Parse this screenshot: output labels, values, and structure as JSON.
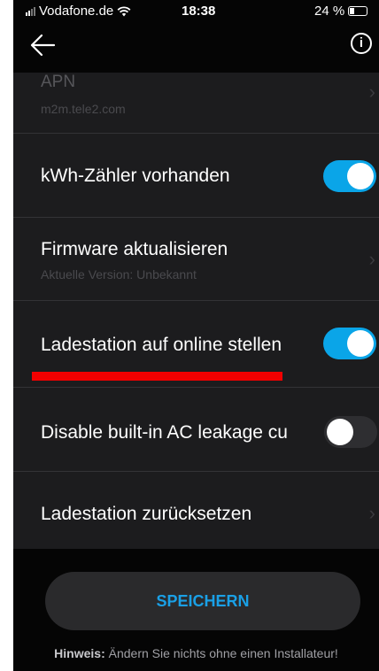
{
  "status_bar": {
    "carrier": "Vodafone.de",
    "time": "18:38",
    "battery": "24 %"
  },
  "settings": {
    "apn": {
      "label": "APN",
      "value": "m2m.tele2.com"
    },
    "kwh_meter": {
      "label": "kWh-Zähler vorhanden",
      "enabled": true
    },
    "firmware": {
      "label": "Firmware aktualisieren",
      "version": "Aktuelle Version: Unbekannt"
    },
    "online": {
      "label": "Ladestation auf online stellen",
      "enabled": true
    },
    "leakage": {
      "label": "Disable built-in AC leakage cu",
      "enabled": false
    },
    "reset": {
      "label": "Ladestation zurücksetzen"
    }
  },
  "footer": {
    "save_label": "SPEICHERN",
    "hint_bold": "Hinweis:",
    "hint_text": " Ändern Sie nichts ohne einen Installateur!"
  },
  "colors": {
    "accent": "#0aa5e8",
    "annotation": "#f20000",
    "background": "#1c1c1e"
  },
  "icons": [
    "wifi-icon",
    "back-arrow-icon",
    "info-icon",
    "chevron-right-icon"
  ]
}
